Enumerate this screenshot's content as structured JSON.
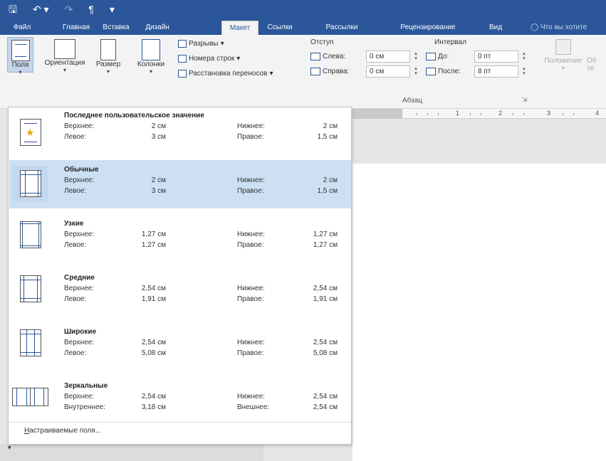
{
  "quick_access": {
    "save_icon": "save-icon",
    "undo_icon": "undo-icon",
    "redo_icon": "redo-icon",
    "paragraph_icon": "pilcrow-icon",
    "customize_icon": "customize-qat-icon",
    "undo_glyph": "↶ ▾",
    "redo_glyph": "↷",
    "paragraph_glyph": "¶",
    "customize_glyph": "▾"
  },
  "tabs": [
    {
      "label": "Файл"
    },
    {
      "label": "Главная"
    },
    {
      "label": "Вставка"
    },
    {
      "label": "Дизайн"
    },
    {
      "label": "Макет"
    },
    {
      "label": "Ссылки"
    },
    {
      "label": "Рассылки"
    },
    {
      "label": "Рецензирование"
    },
    {
      "label": "Вид"
    },
    {
      "label": "Что вы хотите"
    }
  ],
  "active_tab": "Макет",
  "ribbon": {
    "margins_label": "Поля",
    "orientation_label": "Ориентация",
    "size_label": "Размер",
    "columns_label": "Колонки",
    "breaks_label": "Разрывы",
    "line_numbers_label": "Номера строк",
    "hyphenation_label": "Расстановка переносов",
    "indent_label": "Отступ",
    "indent_left_label": "Слева:",
    "indent_left_value": "0 см",
    "indent_right_label": "Справа:",
    "indent_right_value": "0 см",
    "spacing_label": "Интервал",
    "spacing_before_label": "До:",
    "spacing_before_value": "0 пт",
    "spacing_after_label": "После:",
    "spacing_after_value": "8 пт",
    "paragraph_group_label": "Абзац",
    "position_label": "Положение",
    "wrap_label_partial": "Об",
    "wrap_label_second_line": "те"
  },
  "ruler": {
    "marks": [
      "1",
      "2",
      "3",
      "4"
    ]
  },
  "margins_menu": {
    "items": [
      {
        "title": "Последнее пользовательское значение",
        "icon": "star-margins-icon",
        "top_label": "Верхнее:",
        "top_value": "2 см",
        "bottom_label": "Нижнее:",
        "bottom_value": "2 см",
        "left_label": "Левое:",
        "left_value": "3 см",
        "right_label": "Правое:",
        "right_value": "1,5 см"
      },
      {
        "title": "Обычные",
        "icon": "normal-margins-icon",
        "top_label": "Верхнее:",
        "top_value": "2 см",
        "bottom_label": "Нижнее:",
        "bottom_value": "2 см",
        "left_label": "Левое:",
        "left_value": "3 см",
        "right_label": "Правое:",
        "right_value": "1,5 см"
      },
      {
        "title": "Узкие",
        "icon": "narrow-margins-icon",
        "top_label": "Верхнее:",
        "top_value": "1,27 см",
        "bottom_label": "Нижнее:",
        "bottom_value": "1,27 см",
        "left_label": "Левое:",
        "left_value": "1,27 см",
        "right_label": "Правое:",
        "right_value": "1,27 см"
      },
      {
        "title": "Средние",
        "icon": "moderate-margins-icon",
        "top_label": "Верхнее:",
        "top_value": "2,54 см",
        "bottom_label": "Нижнее:",
        "bottom_value": "2,54 см",
        "left_label": "Левое:",
        "left_value": "1,91 см",
        "right_label": "Правое:",
        "right_value": "1,91 см"
      },
      {
        "title": "Широкие",
        "icon": "wide-margins-icon",
        "top_label": "Верхнее:",
        "top_value": "2,54 см",
        "bottom_label": "Нижнее:",
        "bottom_value": "2,54 см",
        "left_label": "Левое:",
        "left_value": "5,08 см",
        "right_label": "Правое:",
        "right_value": "5,08 см"
      },
      {
        "title": "Зеркальные",
        "icon": "mirrored-margins-icon",
        "top_label": "Верхнее:",
        "top_value": "2,54 см",
        "bottom_label": "Нижнее:",
        "bottom_value": "2,54 см",
        "left_label": "Внутреннее:",
        "left_value": "3,18 см",
        "right_label": "Внешнее:",
        "right_value": "2,54 см"
      }
    ],
    "custom_label_underlined": "Н",
    "custom_label_rest": "астраиваемые поля..."
  },
  "colors": {
    "accent": "#2b579a",
    "selected_item": "#cde0f3",
    "star": "#e8a800"
  }
}
